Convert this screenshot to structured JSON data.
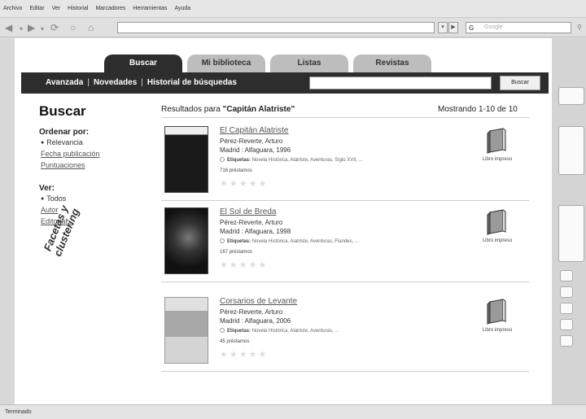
{
  "browser": {
    "menu": [
      "Archivo",
      "Editar",
      "Ver",
      "Historial",
      "Marcadores",
      "Herramientas",
      "Ayuda"
    ],
    "search_placeholder": "Google",
    "status": "Terminado"
  },
  "tabs": [
    {
      "label": "Buscar",
      "active": true
    },
    {
      "label": "Mi biblioteca",
      "active": false
    },
    {
      "label": "Listas",
      "active": false
    },
    {
      "label": "Revistas",
      "active": false
    }
  ],
  "toolbar": {
    "links": [
      "Avanzada",
      "Novedades",
      "Historial de búsquedas"
    ],
    "search_button": "Buscar"
  },
  "page_title": "Buscar",
  "results_header": {
    "prefix": "Resultados para",
    "query": "\"Capitán Alatriste\"",
    "showing": "Mostrando 1-10 de 10"
  },
  "facets": {
    "sort_heading": "Ordenar por:",
    "sort_options": [
      "Relevancia",
      "Fecha publicación",
      "Puntuaciones"
    ],
    "view_heading": "Ver:",
    "view_options": [
      "Todos",
      "Autor",
      "Editorial..."
    ],
    "annotation": "Facetas y clustering"
  },
  "results": [
    {
      "title": "El Capitán Alatriste",
      "author": "Pérez-Reverte, Arturo",
      "publication": "Madrid : Alfaguara, 1996",
      "tags_label": "Etiquetas:",
      "tags": "Novela Histórica, Alatriste, Aventuras, Siglo XVII, ...",
      "loans": "716 préstamos",
      "format": "Libro impreso"
    },
    {
      "title": "El Sol de Breda",
      "author": "Pérez-Reverte, Arturo",
      "publication": "Madrid : Alfaguara, 1998",
      "tags_label": "Etiquetas:",
      "tags": "Novela Histórica, Alatriste, Aventuras, Flandes, ...",
      "loans": "167 préstamos",
      "format": "Libro impreso"
    },
    {
      "title": "Corsarios de Levante",
      "author": "Pérez-Reverte, Arturo",
      "publication": "Madrid : Alfaguara, 2006",
      "tags_label": "Etiquetas:",
      "tags": "Novela Histórica, Alatriste, Aventuras, ...",
      "loans": "45 préstamos",
      "format": "Libro impreso"
    }
  ],
  "icons": {
    "rating": "star-icon",
    "format": "book-icon",
    "tags": "tag-icon"
  }
}
